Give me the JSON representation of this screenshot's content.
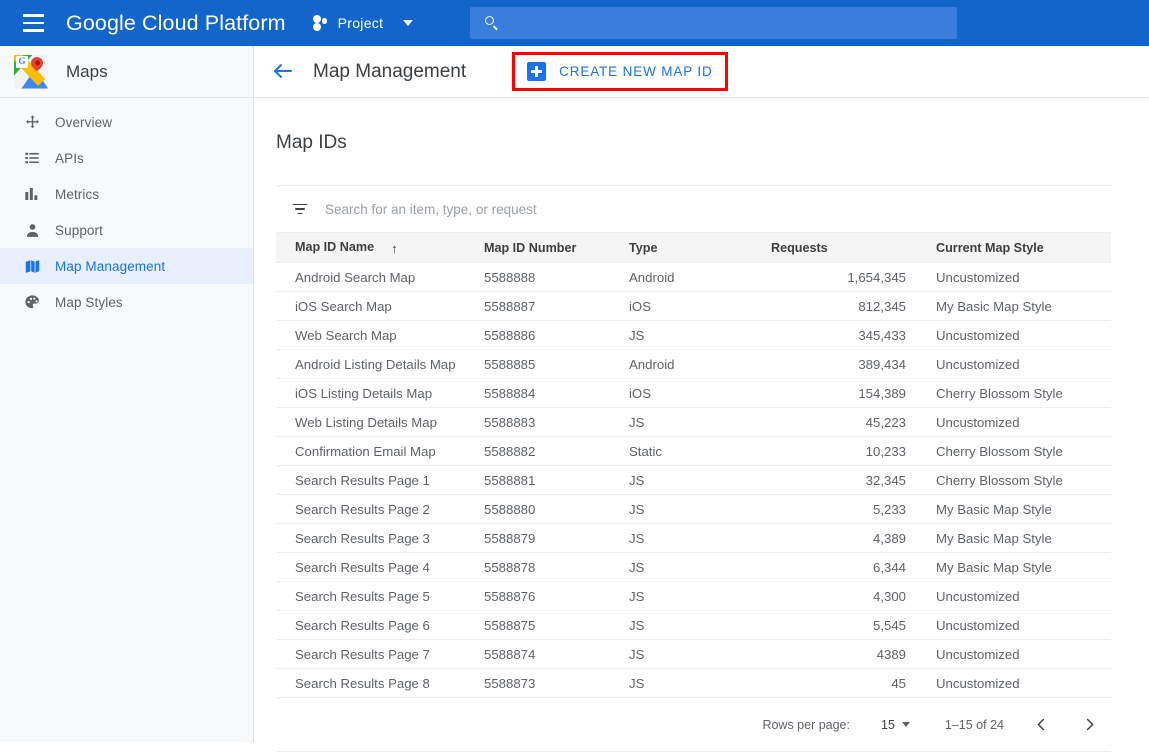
{
  "topbar": {
    "menu_icon": "hamburger-icon",
    "brand_bold": "Google",
    "brand_light": " Cloud Platform",
    "project_label": "Project",
    "project_icon": "project-dots-icon",
    "caret_icon": "chevron-down-icon",
    "search_icon": "search-icon",
    "search_value": "",
    "search_placeholder": "",
    "bg_color": "#1266c9",
    "search_bg_color": "#3b7ddd"
  },
  "sidebar": {
    "product_title": "Maps",
    "product_logo_icon": "google-maps-logo-icon",
    "active_index": 4,
    "active_bg_color": "#e8f0fe",
    "active_fg_color": "#1a73e8",
    "items": [
      {
        "label": "Overview",
        "icon": "overview-move-icon"
      },
      {
        "label": "APIs",
        "icon": "list-icon"
      },
      {
        "label": "Metrics",
        "icon": "bar-chart-icon"
      },
      {
        "label": "Support",
        "icon": "person-icon"
      },
      {
        "label": "Map Management",
        "icon": "map-icon"
      },
      {
        "label": "Map Styles",
        "icon": "palette-icon"
      }
    ]
  },
  "page_header": {
    "back_icon": "back-arrow-icon",
    "title": "Map Management",
    "create_button_label": "CREATE NEW MAP ID",
    "create_button_icon": "plus-square-icon",
    "highlight_color": "#ff0000",
    "accent_color": "#1a73e8"
  },
  "main": {
    "section_title": "Map IDs",
    "filter": {
      "icon": "filter-list-icon",
      "value": "",
      "placeholder": "Search for an item, type, or request"
    },
    "table": {
      "columns": [
        {
          "label": "Map ID Name",
          "sorted": true,
          "sort_icon": "↑"
        },
        {
          "label": "Map ID Number",
          "sorted": false
        },
        {
          "label": "Type",
          "sorted": false
        },
        {
          "label": "Requests",
          "sorted": false
        },
        {
          "label": "Current Map Style",
          "sorted": false
        }
      ],
      "rows": [
        {
          "name": "Android Search Map",
          "number": "5588888",
          "type": "Android",
          "requests": "1,654,345",
          "style": "Uncustomized"
        },
        {
          "name": "iOS Search Map",
          "number": "5588887",
          "type": "iOS",
          "requests": "812,345",
          "style": "My Basic Map Style"
        },
        {
          "name": "Web Search Map",
          "number": "5588886",
          "type": "JS",
          "requests": "345,433",
          "style": "Uncustomized"
        },
        {
          "name": "Android Listing Details Map",
          "number": "5588885",
          "type": "Android",
          "requests": "389,434",
          "style": "Uncustomized"
        },
        {
          "name": "iOS Listing Details Map",
          "number": "5588884",
          "type": "iOS",
          "requests": "154,389",
          "style": "Cherry Blossom Style"
        },
        {
          "name": "Web Listing Details Map",
          "number": "5588883",
          "type": "JS",
          "requests": "45,223",
          "style": "Uncustomized"
        },
        {
          "name": "Confirmation Email Map",
          "number": "5588882",
          "type": "Static",
          "requests": "10,233",
          "style": "Cherry Blossom Style"
        },
        {
          "name": "Search Results Page 1",
          "number": "5588881",
          "type": "JS",
          "requests": "32,345",
          "style": "Cherry Blossom Style"
        },
        {
          "name": "Search Results Page 2",
          "number": "5588880",
          "type": "JS",
          "requests": "5,233",
          "style": "My Basic Map Style"
        },
        {
          "name": "Search Results Page 3",
          "number": "5588879",
          "type": "JS",
          "requests": "4,389",
          "style": "My Basic Map Style"
        },
        {
          "name": "Search Results Page 4",
          "number": "5588878",
          "type": "JS",
          "requests": "6,344",
          "style": "My Basic Map Style"
        },
        {
          "name": "Search Results Page 5",
          "number": "5588876",
          "type": "JS",
          "requests": "4,300",
          "style": "Uncustomized"
        },
        {
          "name": "Search Results Page 6",
          "number": "5588875",
          "type": "JS",
          "requests": "5,545",
          "style": "Uncustomized"
        },
        {
          "name": "Search Results Page 7",
          "number": "5588874",
          "type": "JS",
          "requests": "4389",
          "style": "Uncustomized"
        },
        {
          "name": "Search Results Page 8",
          "number": "5588873",
          "type": "JS",
          "requests": "45",
          "style": "Uncustomized"
        }
      ]
    },
    "pagination": {
      "rows_per_page_label": "Rows per page:",
      "rows_per_page_value": "15",
      "range_label": "1–15 of 24",
      "prev_icon": "chevron-left-icon",
      "next_icon": "chevron-right-icon"
    }
  }
}
